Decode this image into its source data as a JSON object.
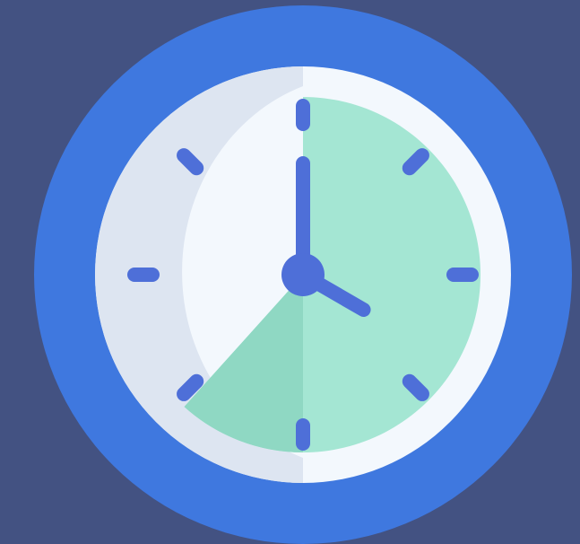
{
  "clock": {
    "icon": "clock-icon",
    "time_shown": "4:00",
    "hour": 4,
    "minute": 0,
    "highlighted_sector_from_hour": 0,
    "highlighted_sector_to_hour": 7.4
  },
  "colors": {
    "background": "#435282",
    "rim": "#3f78df",
    "face": "#f3f8fd",
    "face_shadow": "#dde5f1",
    "sector": "#a4e6d3",
    "sector_shadow": "#8fd8c3",
    "hands_and_marks": "#4e6fd8"
  }
}
